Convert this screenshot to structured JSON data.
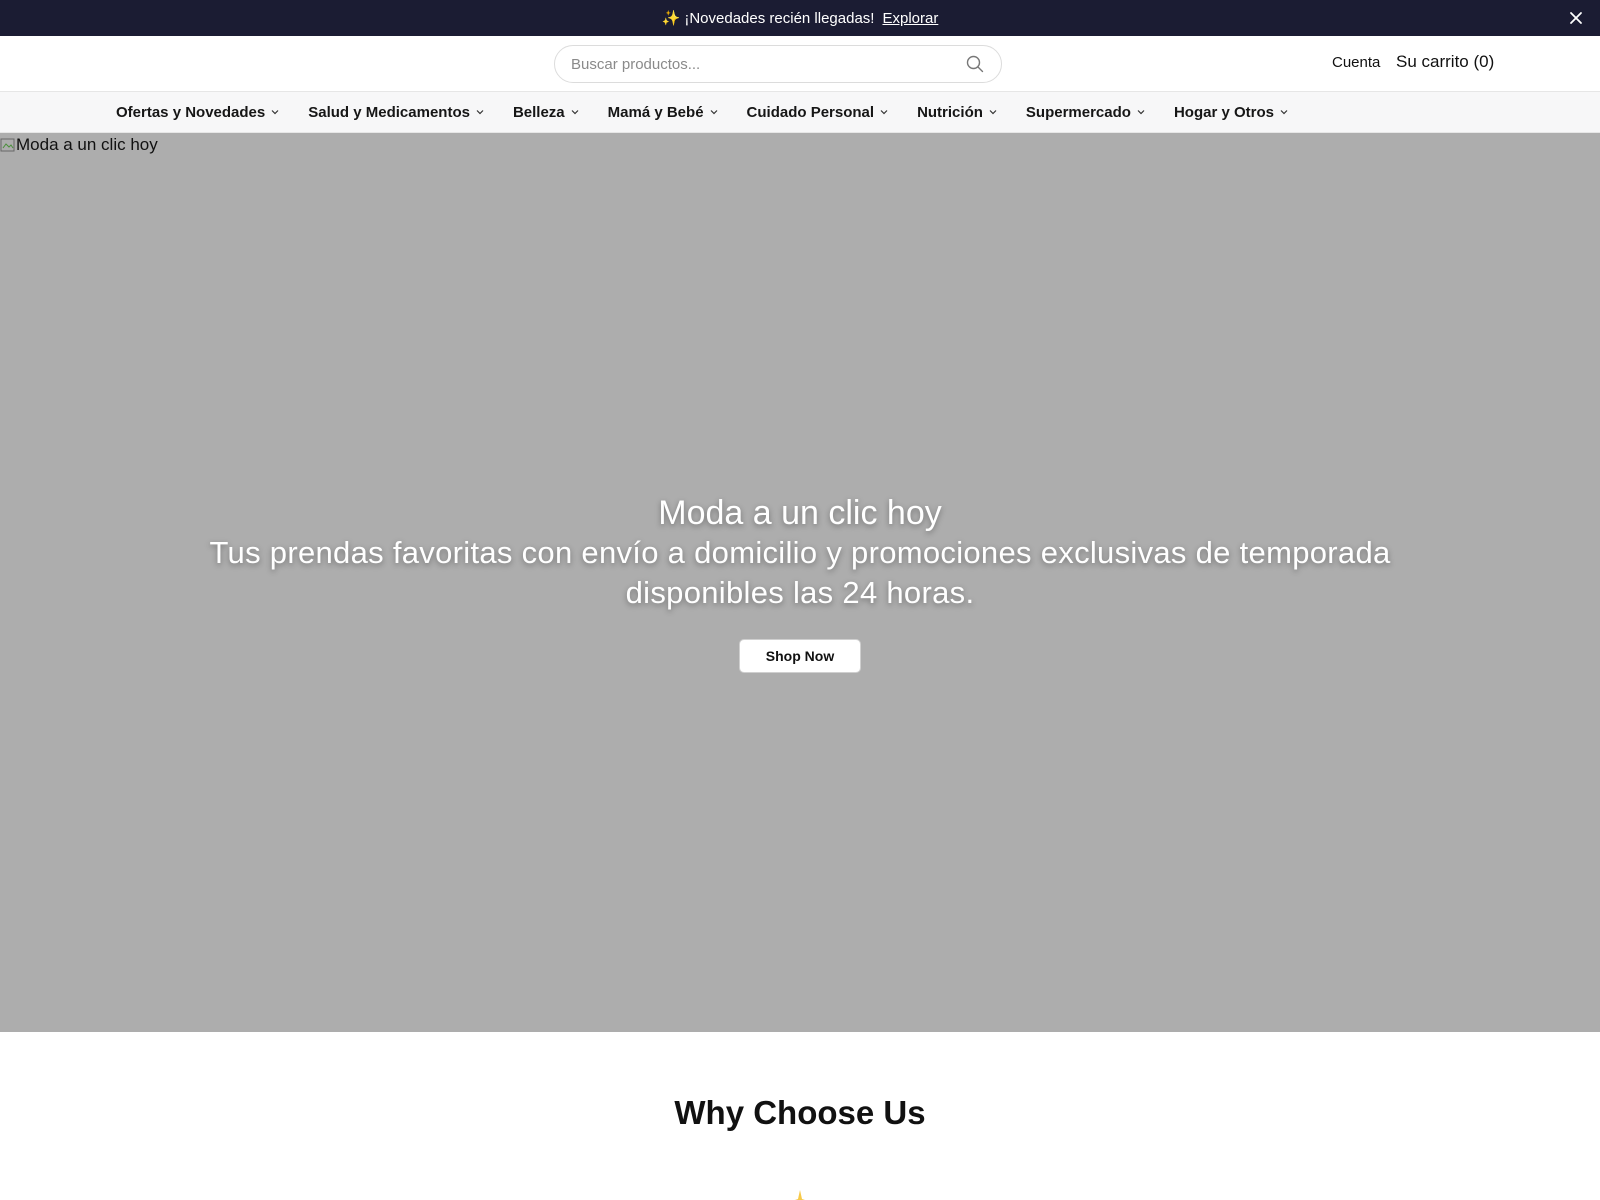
{
  "announcement": {
    "text": "¡Novedades recién llegadas!",
    "link_label": "Explorar"
  },
  "header": {
    "search_placeholder": "Buscar productos...",
    "account_label": "Cuenta",
    "cart_label": "Su carrito (0)"
  },
  "nav": {
    "items": [
      {
        "label": "Ofertas y Novedades"
      },
      {
        "label": "Salud y Medicamentos"
      },
      {
        "label": "Belleza"
      },
      {
        "label": "Mamá y Bebé"
      },
      {
        "label": "Cuidado Personal"
      },
      {
        "label": "Nutrición"
      },
      {
        "label": "Supermercado"
      },
      {
        "label": "Hogar y Otros"
      }
    ]
  },
  "hero": {
    "image_alt": "Moda a un clic hoy",
    "title": "Moda a un clic hoy",
    "subtitle": "Tus prendas favoritas con envío a domicilio y promociones exclusivas de temporada disponibles las 24 horas.",
    "button_label": "Shop Now"
  },
  "why": {
    "title": "Why Choose Us"
  },
  "colors": {
    "announcement_bg": "#1b1c33",
    "hero_bg": "#adadad",
    "accent_sparkle": "#f7c948"
  }
}
